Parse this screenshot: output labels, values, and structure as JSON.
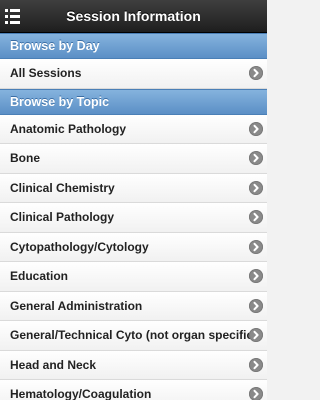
{
  "header": {
    "title": "Session Information"
  },
  "browse_by_day": {
    "heading": "Browse by Day",
    "items": [
      {
        "label": "All Sessions"
      }
    ]
  },
  "browse_by_topic": {
    "heading": "Browse by Topic",
    "items": [
      {
        "label": "Anatomic Pathology"
      },
      {
        "label": "Bone"
      },
      {
        "label": "Clinical Chemistry"
      },
      {
        "label": "Clinical Pathology"
      },
      {
        "label": "Cytopathology/Cytology"
      },
      {
        "label": "Education"
      },
      {
        "label": "General Administration"
      },
      {
        "label": "General/Technical Cyto (not organ specific)"
      },
      {
        "label": "Head and Neck"
      },
      {
        "label": "Hematology/Coagulation"
      }
    ]
  },
  "icons": {
    "menu": "list-menu-icon",
    "item_arrow": "chevron-right-circle-icon"
  },
  "colors": {
    "header_bg": "#2b2b2b",
    "divider_bg": "#6b9ed2",
    "item_bg": "#f7f7f7",
    "chevron_bg": "#8a8a8a"
  }
}
